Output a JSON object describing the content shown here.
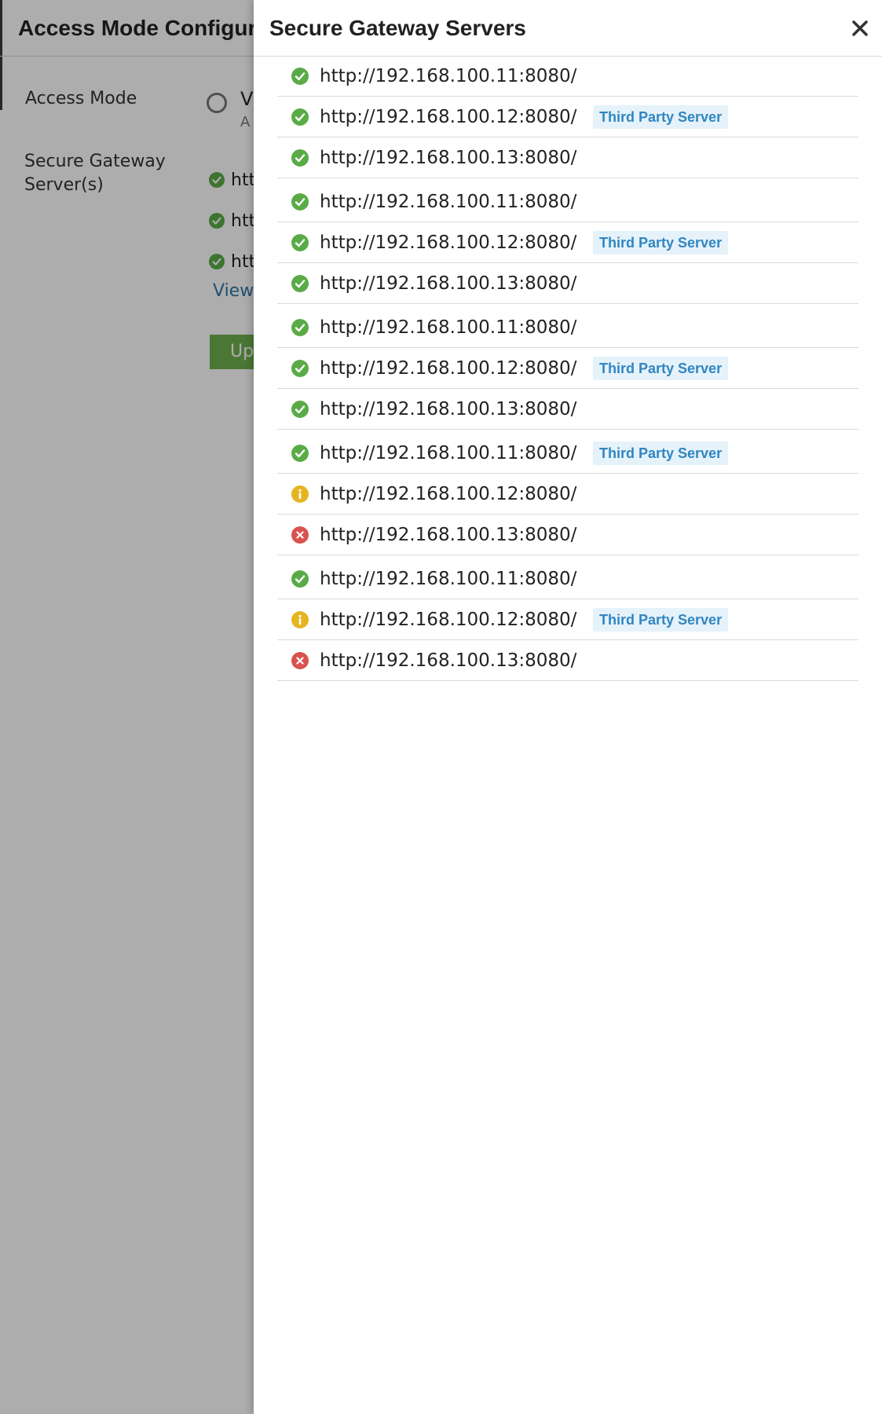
{
  "background_page": {
    "title": "Access Mode Configurat",
    "access_mode_label": "Access Mode",
    "radio_option_text": "V",
    "radio_option_subtext": "A",
    "secure_gateway_label": "Secure Gateway Server(s)",
    "server_items": [
      {
        "status": "ok",
        "text": "htt"
      },
      {
        "status": "ok",
        "text": "htt"
      },
      {
        "status": "ok",
        "text": "htt"
      }
    ],
    "view_link": "View",
    "update_button": "Up"
  },
  "drawer": {
    "title": "Secure Gateway Servers",
    "close_icon": "close-icon",
    "servers": [
      {
        "url": "http://192.168.100.11:8080/",
        "status": "ok",
        "badge": ""
      },
      {
        "url": "http://192.168.100.12:8080/",
        "status": "ok",
        "badge": "Third Party Server"
      },
      {
        "url": "http://192.168.100.13:8080/",
        "status": "ok",
        "badge": ""
      },
      {
        "url": "http://192.168.100.11:8080/",
        "status": "ok",
        "badge": ""
      },
      {
        "url": "http://192.168.100.12:8080/",
        "status": "ok",
        "badge": "Third Party Server"
      },
      {
        "url": "http://192.168.100.13:8080/",
        "status": "ok",
        "badge": ""
      },
      {
        "url": "http://192.168.100.11:8080/",
        "status": "ok",
        "badge": ""
      },
      {
        "url": "http://192.168.100.12:8080/",
        "status": "ok",
        "badge": "Third Party Server"
      },
      {
        "url": "http://192.168.100.13:8080/",
        "status": "ok",
        "badge": ""
      },
      {
        "url": "http://192.168.100.11:8080/",
        "status": "ok",
        "badge": "Third Party Server"
      },
      {
        "url": "http://192.168.100.12:8080/",
        "status": "warning",
        "badge": ""
      },
      {
        "url": "http://192.168.100.13:8080/",
        "status": "error",
        "badge": ""
      },
      {
        "url": "http://192.168.100.11:8080/",
        "status": "ok",
        "badge": ""
      },
      {
        "url": "http://192.168.100.12:8080/",
        "status": "warning",
        "badge": "Third Party Server"
      },
      {
        "url": "http://192.168.100.13:8080/",
        "status": "error",
        "badge": ""
      }
    ]
  },
  "colors": {
    "ok": "#5aab47",
    "warning": "#e5b422",
    "error": "#d9534f",
    "badge_bg": "#e6f2fa",
    "badge_text": "#2f86c2",
    "link": "#2f77a8",
    "update_button": "#6fb04f"
  }
}
